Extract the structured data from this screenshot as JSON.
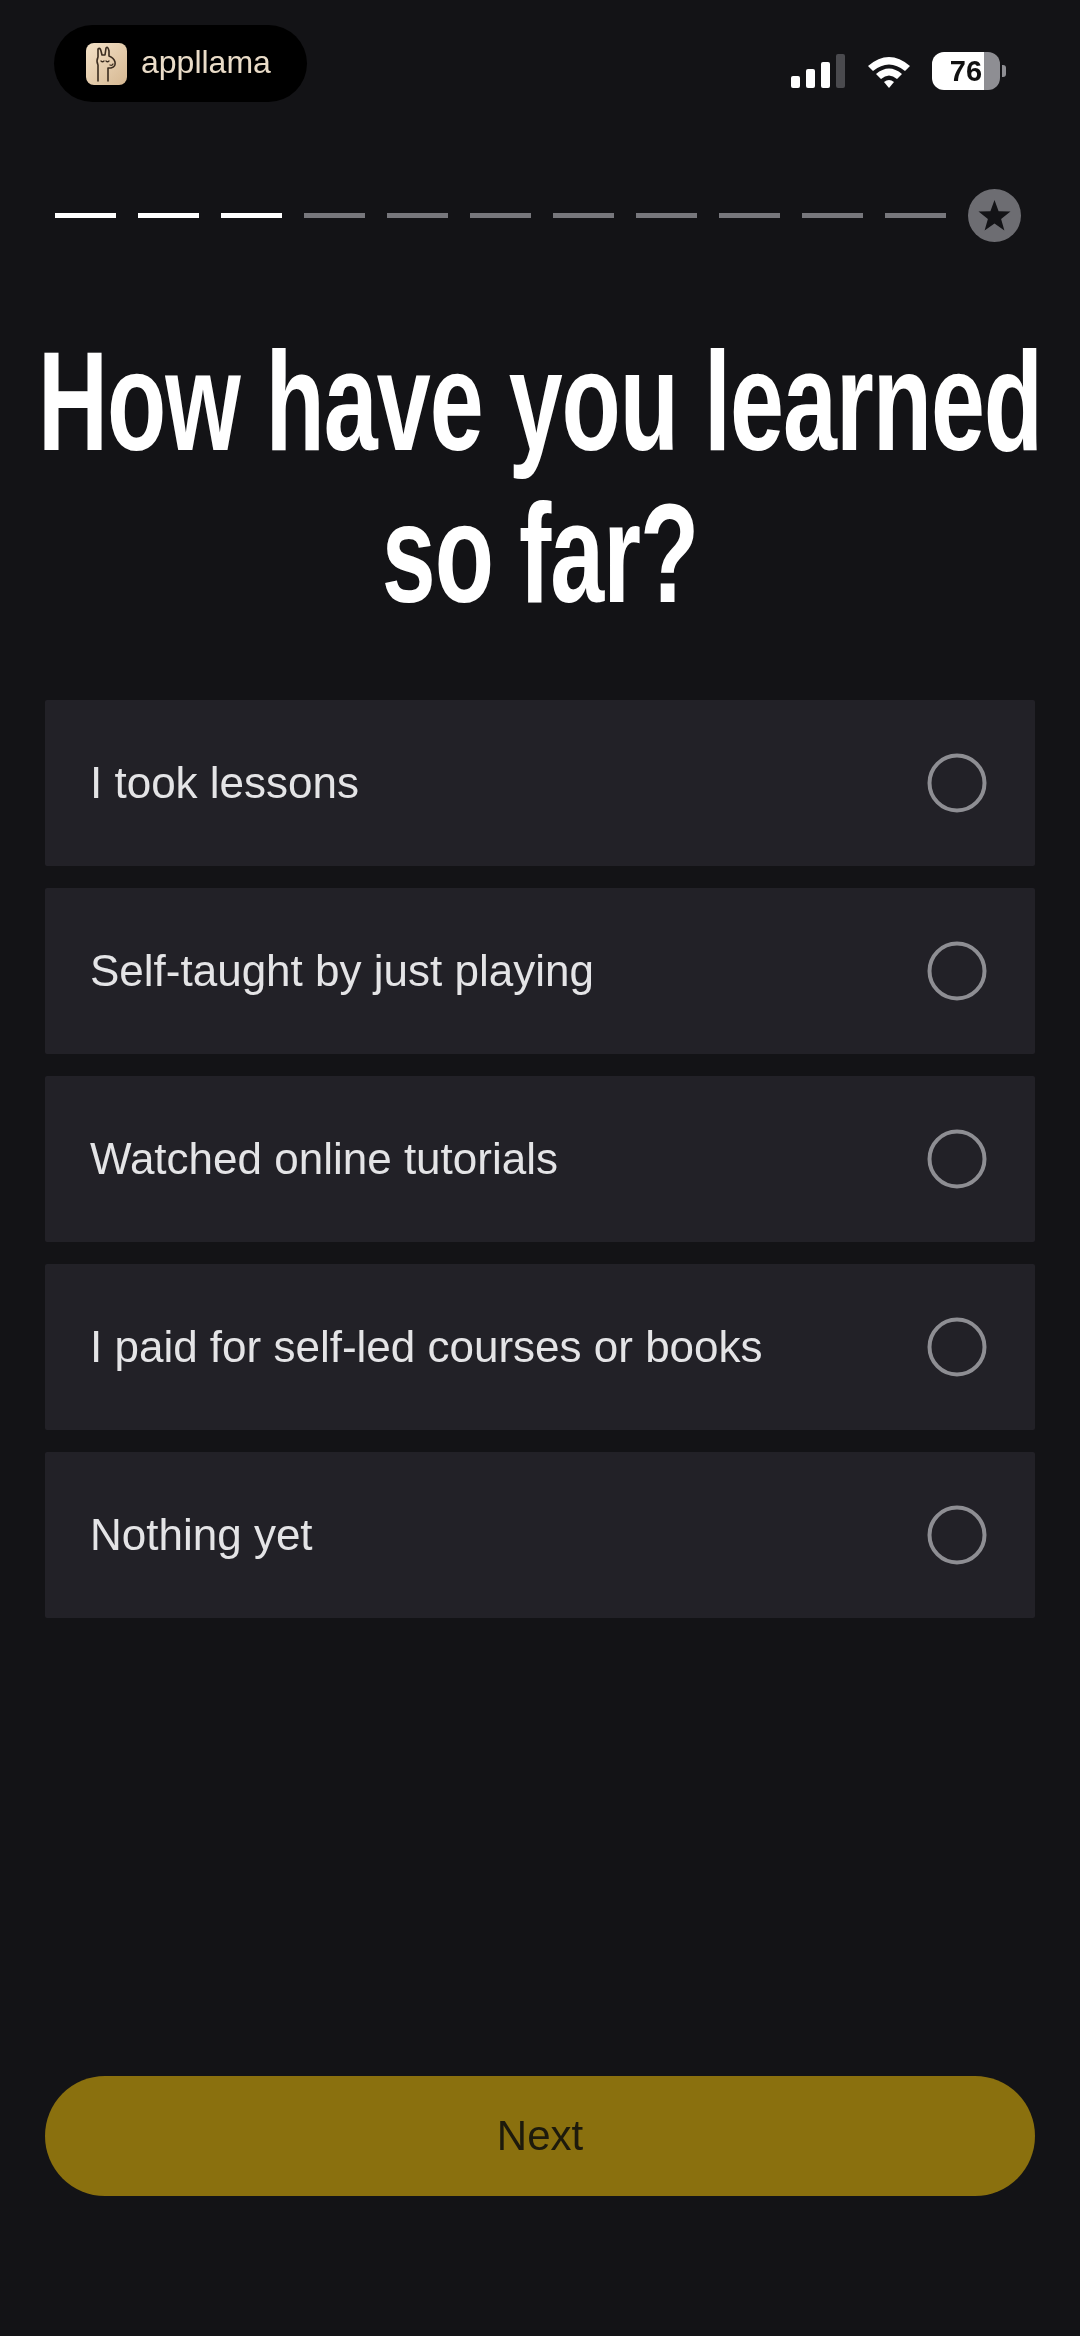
{
  "status_bar": {
    "app_name": "appllama",
    "battery": "76"
  },
  "progress": {
    "steps": [
      {
        "done": true
      },
      {
        "done": true
      },
      {
        "done": true
      },
      {
        "done": false
      },
      {
        "done": false
      },
      {
        "done": false
      },
      {
        "done": false
      },
      {
        "done": false
      },
      {
        "done": false
      },
      {
        "done": false
      },
      {
        "done": false
      }
    ]
  },
  "title": "How have you learned so far?",
  "options": [
    {
      "label": "I took lessons",
      "selected": false
    },
    {
      "label": "Self-taught by just playing",
      "selected": false
    },
    {
      "label": "Watched online tutorials",
      "selected": false
    },
    {
      "label": "I paid for self-led courses or books",
      "selected": false
    },
    {
      "label": "Nothing yet",
      "selected": false
    }
  ],
  "next_button": {
    "label": "Next",
    "disabled": true
  }
}
